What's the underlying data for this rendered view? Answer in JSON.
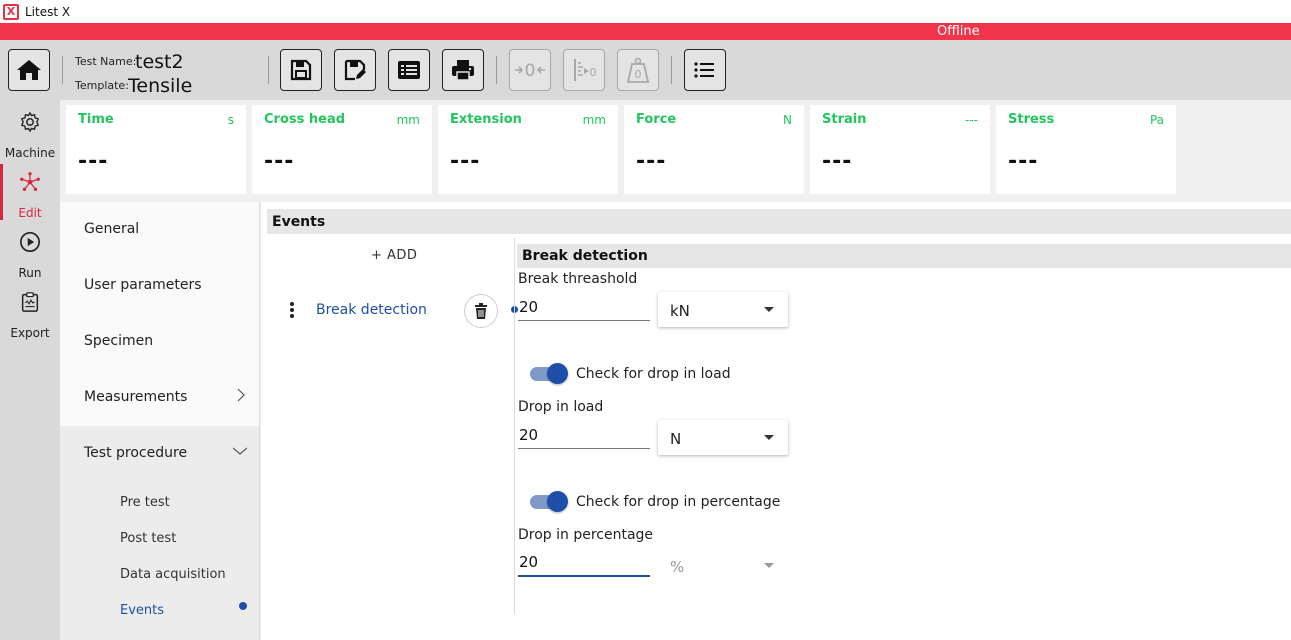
{
  "app": {
    "title": "Litest X",
    "logo_letter": "X"
  },
  "status": {
    "text": "Offline",
    "color": "#f0344a"
  },
  "test_info": {
    "name_label": "Test Name:",
    "name_value": "test2",
    "template_label": "Template:",
    "template_value": "Tensile"
  },
  "toolbar": {
    "icons": [
      "home-icon",
      "save-icon",
      "save-as-icon",
      "list-details-icon",
      "print-icon",
      "zero-icon",
      "extensometer-zero-icon",
      "tare-load-icon",
      "menu-list-icon"
    ],
    "zero_text": "0",
    "tare_text": "0"
  },
  "leftnav": {
    "items": [
      {
        "label": "Machine",
        "icon": "gear-icon"
      },
      {
        "label": "Edit",
        "icon": "nodes-icon",
        "active": true
      },
      {
        "label": "Run",
        "icon": "play-icon"
      },
      {
        "label": "Export",
        "icon": "clipboard-icon"
      }
    ]
  },
  "cards": [
    {
      "label": "Time",
      "unit": "s",
      "value": "---"
    },
    {
      "label": "Cross head",
      "unit": "mm",
      "value": "---"
    },
    {
      "label": "Extension",
      "unit": "mm",
      "value": "---"
    },
    {
      "label": "Force",
      "unit": "N",
      "value": "---"
    },
    {
      "label": "Strain",
      "unit": "---",
      "value": "---"
    },
    {
      "label": "Stress",
      "unit": "Pa",
      "value": "---"
    }
  ],
  "menu": {
    "items": [
      {
        "label": "General"
      },
      {
        "label": "User parameters"
      },
      {
        "label": "Specimen"
      },
      {
        "label": "Measurements"
      },
      {
        "label": "Test procedure"
      }
    ],
    "subitems": [
      {
        "label": "Pre test"
      },
      {
        "label": "Post test"
      },
      {
        "label": "Data acquisition"
      },
      {
        "label": "Events",
        "active": true
      }
    ]
  },
  "events": {
    "title": "Events",
    "add_label": "+ ADD",
    "list": [
      {
        "label": "Break detection"
      }
    ]
  },
  "break_detection": {
    "title": "Break detection",
    "threshold_label": "Break threashold",
    "threshold_value": "20",
    "threshold_unit": "kN",
    "drop_load_toggle_label": "Check for drop in load",
    "drop_load_toggle_on": true,
    "drop_load_label": "Drop in load",
    "drop_load_value": "20",
    "drop_load_unit": "N",
    "drop_pct_toggle_label": "Check for drop in percentage",
    "drop_pct_toggle_on": true,
    "drop_pct_label": "Drop in percentage",
    "drop_pct_value": "20",
    "drop_pct_unit": "%"
  },
  "colors": {
    "accent": "#1e4fa8",
    "measure_green": "#22c55e",
    "nav_active": "#d8283d"
  }
}
